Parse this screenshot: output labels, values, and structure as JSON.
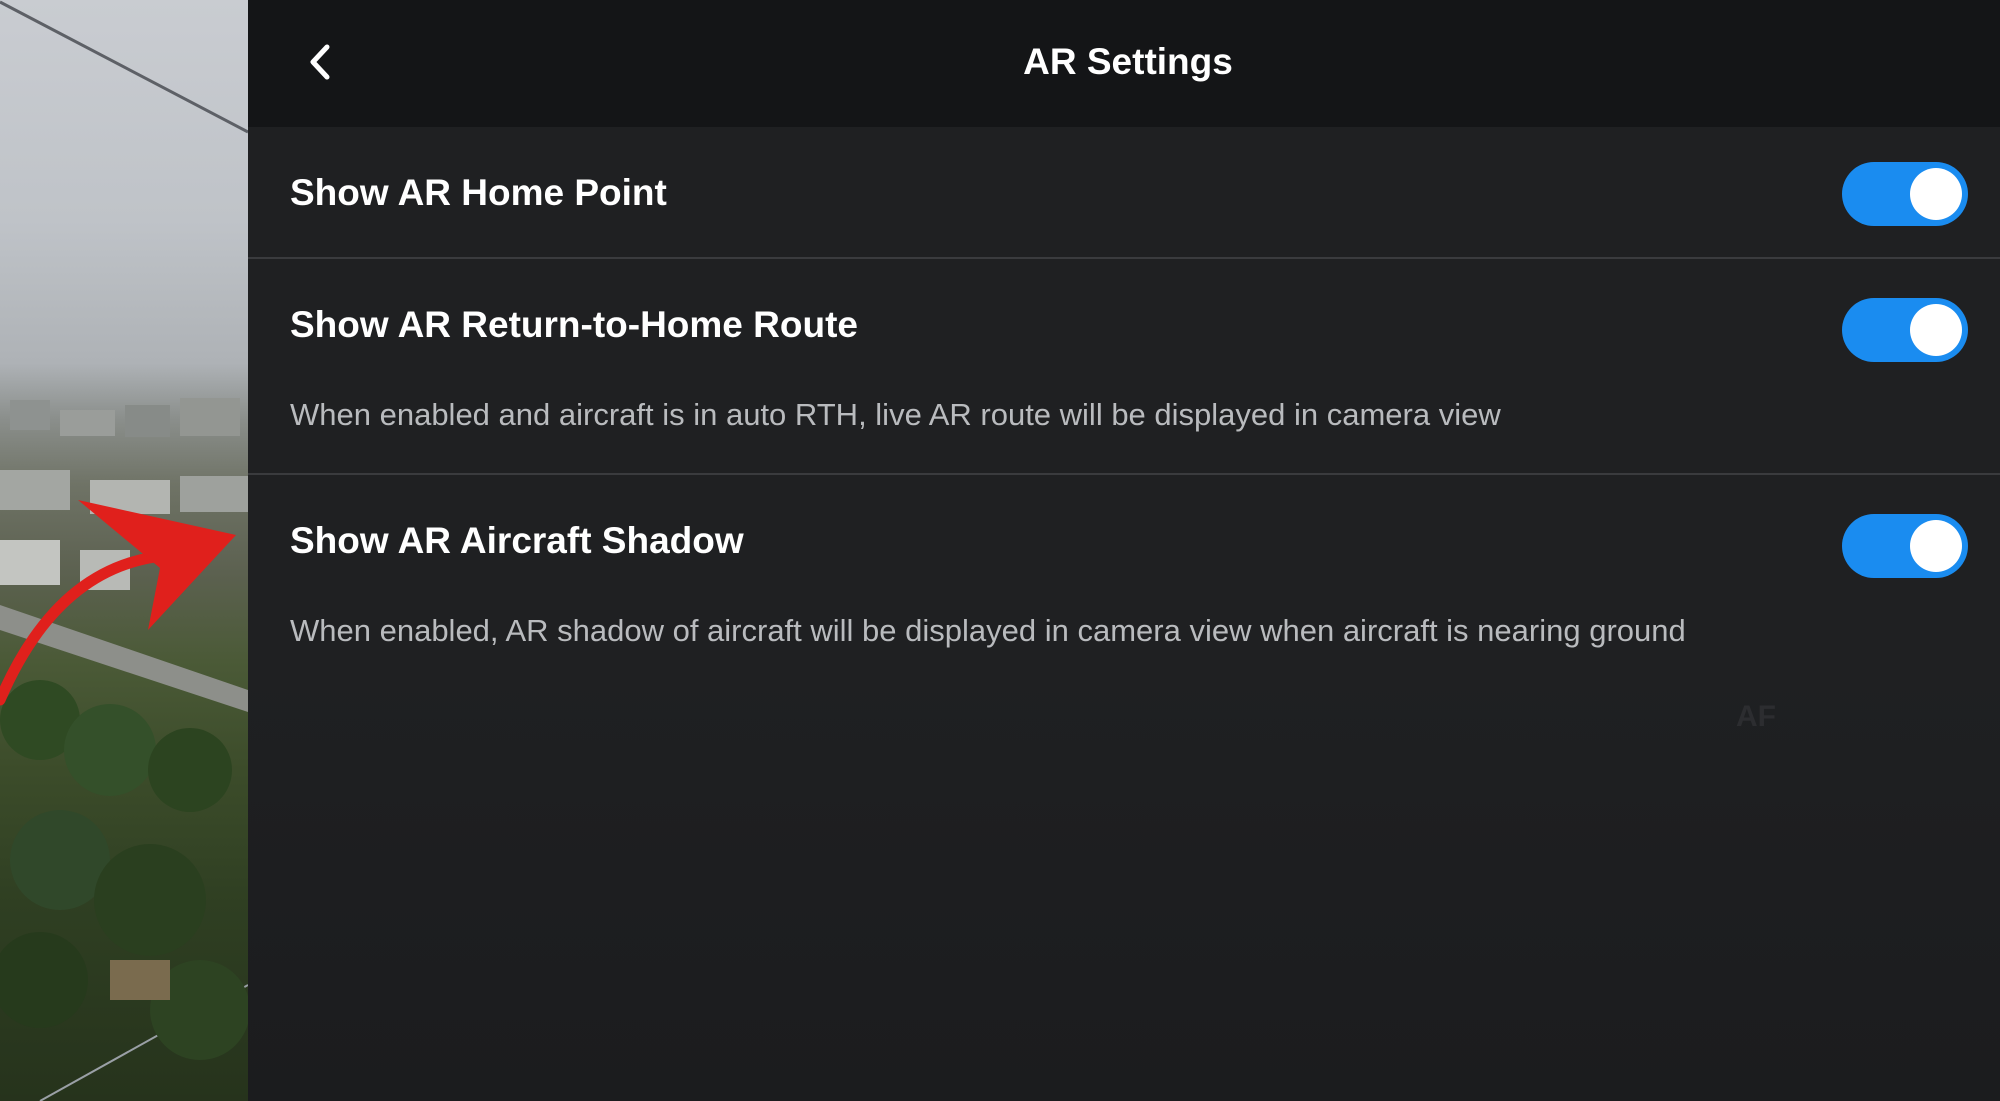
{
  "header": {
    "title": "AR Settings",
    "back_icon": "chevron-left-icon"
  },
  "settings": [
    {
      "label": "Show AR Home Point",
      "description": "",
      "enabled": true
    },
    {
      "label": "Show AR Return-to-Home Route",
      "description": "When enabled and aircraft is in auto RTH, live AR route will be displayed in camera view",
      "enabled": true
    },
    {
      "label": "Show AR Aircraft Shadow",
      "description": "When enabled, AR shadow of aircraft will be displayed in camera view when aircraft is nearing ground",
      "enabled": true
    }
  ],
  "overlay_text": "AF",
  "colors": {
    "toggle_on": "#1a8cf0",
    "header_bg": "#141517",
    "panel_bg": "#1f2022",
    "annotation_arrow": "#e0201c"
  }
}
